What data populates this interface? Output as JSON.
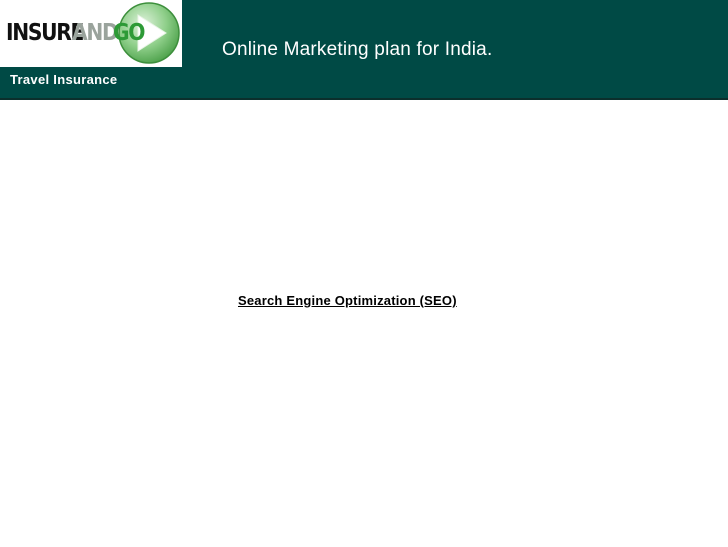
{
  "header": {
    "logo": {
      "insure": "INSURE",
      "and": "AND",
      "go": "GO"
    },
    "tagline": "Travel Insurance",
    "title": "Online Marketing plan for India."
  },
  "content": {
    "heading": "Search Engine Optimization (SEO)"
  },
  "colors": {
    "header_bg": "#004a45",
    "logo_green": "#2d9a36"
  },
  "icons": [
    "arrow-icon"
  ]
}
